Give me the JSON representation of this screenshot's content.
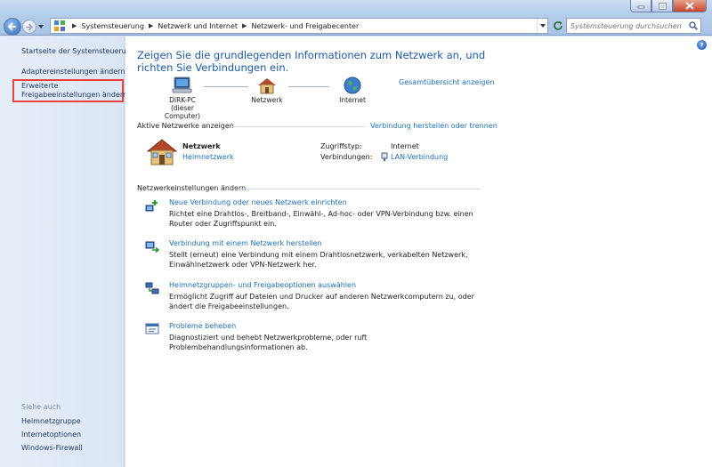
{
  "nav": {
    "breadcrumbs": [
      "Systemsteuerung",
      "Netzwerk und Internet",
      "Netzwerk- und Freigabecenter"
    ],
    "search_placeholder": "Systemsteuerung durchsuchen"
  },
  "left_pane": {
    "home_link": "Startseite der Systemsteuerung",
    "adapter_link": "Adaptereinstellungen ändern",
    "sharing_link_line1": "Erweiterte",
    "sharing_link_line2": "Freigabeeinstellungen ändern",
    "see_also_label": "Siehe auch",
    "see_also": [
      "Heimnetzgruppe",
      "Internetoptionen",
      "Windows-Firewall"
    ],
    "highlight_color": "#e8403a"
  },
  "main": {
    "title": "Zeigen Sie die grundlegenden Informationen zum Netzwerk an, und richten Sie Verbindungen ein.",
    "full_map_link": "Gesamtübersicht anzeigen",
    "map": {
      "computer_name": "DIRK-PC",
      "computer_sub": "(dieser Computer)",
      "network_label": "Netzwerk",
      "internet_label": "Internet"
    },
    "active_networks_header": "Aktive Netzwerke anzeigen",
    "connect_link": "Verbindung herstellen oder trennen",
    "network": {
      "name": "Netzwerk",
      "type": "Heimnetzwerk",
      "access_type_label": "Zugriffstyp:",
      "access_type_value": "Internet",
      "connections_label": "Verbindungen:",
      "connections_value": "LAN-Verbindung"
    },
    "settings_header": "Netzwerkeinstellungen ändern",
    "tasks": [
      {
        "link": "Neue Verbindung oder neues Netzwerk einrichten",
        "desc": "Richtet eine Drahtlos-, Breitband-, Einwähl-, Ad-hoc- oder VPN-Verbindung bzw. einen Router oder Zugriffspunkt ein."
      },
      {
        "link": "Verbindung mit einem Netzwerk herstellen",
        "desc": "Stellt (erneut) eine Verbindung mit einem Drahtlosnetzwerk, verkabelten Netzwerk, Einwählnetzwerk oder VPN-Netzwerk her."
      },
      {
        "link": "Heimnetzgruppen- und Freigabeoptionen auswählen",
        "desc": "Ermöglicht Zugriff auf Dateien und Drucker auf anderen Netzwerkcomputern zu, oder ändert die Freigabeeinstellungen."
      },
      {
        "link": "Probleme beheben",
        "desc": "Diagnostiziert und behebt Netzwerkprobleme, oder ruft Problembehandlungsinformationen ab."
      }
    ]
  },
  "colors": {
    "link": "#1d6fb8",
    "title": "#1d5aa8",
    "sidebar": "#dbe6f4"
  }
}
